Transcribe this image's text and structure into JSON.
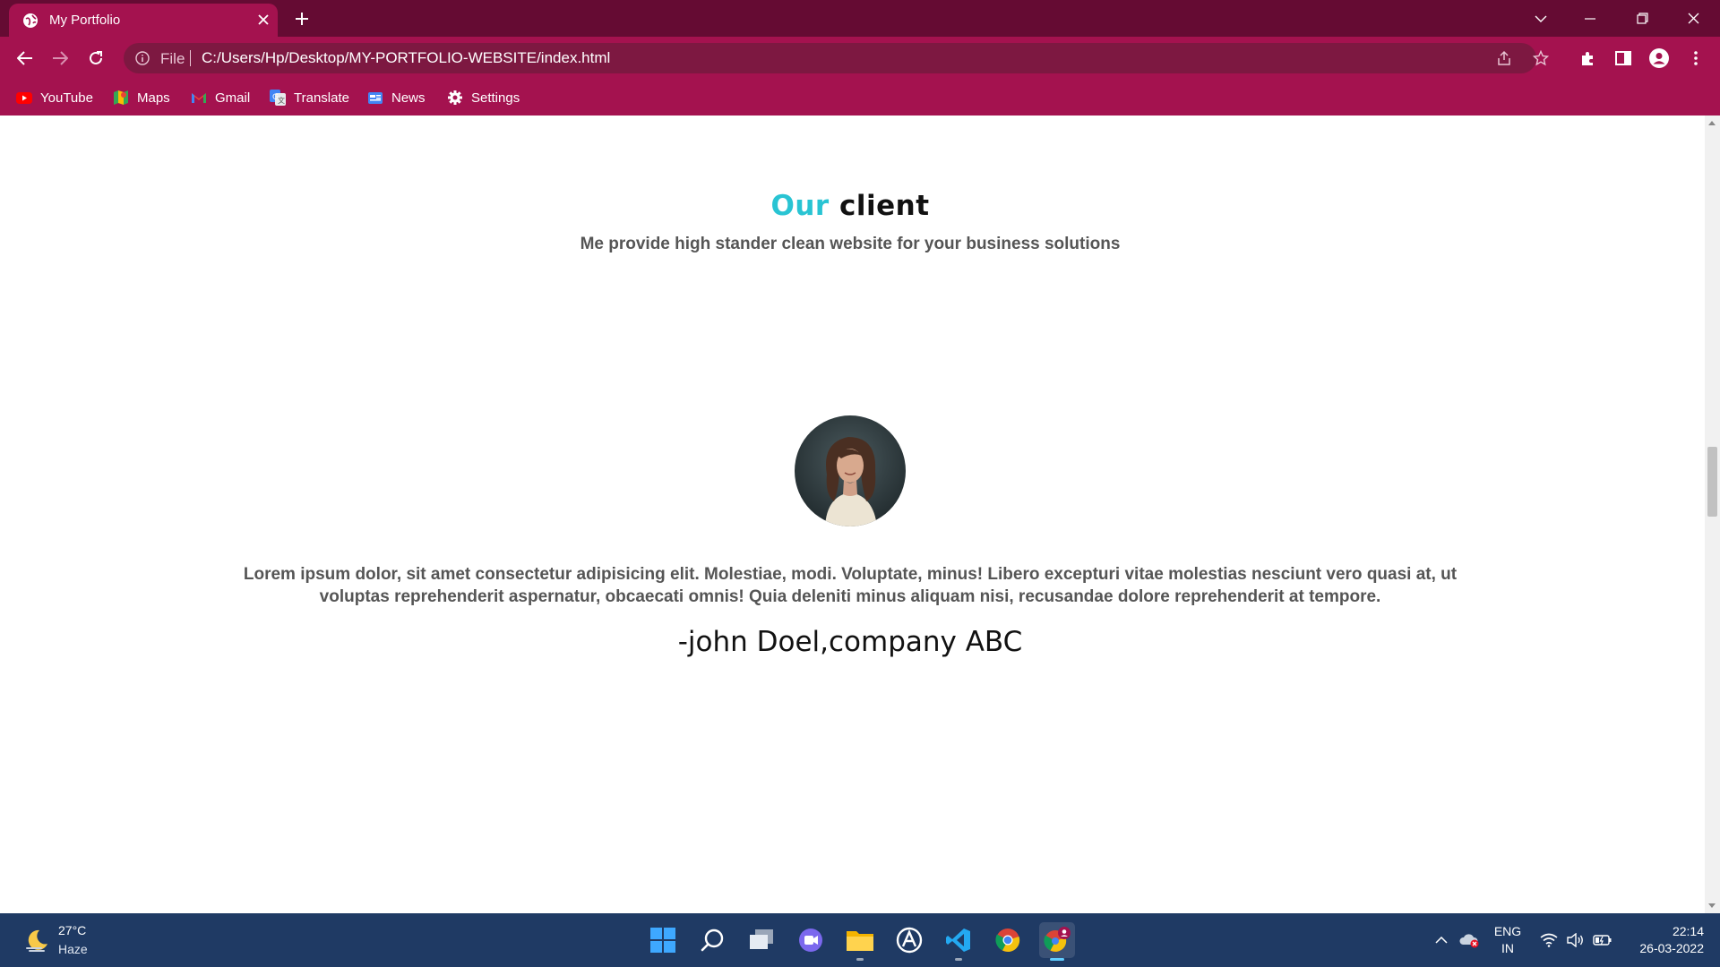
{
  "browser": {
    "tab": {
      "title": "My Portfolio",
      "favicon": "globe-icon"
    },
    "address": {
      "scheme_label": "File",
      "url": "C:/Users/Hp/Desktop/MY-PORTFOLIO-WEBSITE/index.html"
    },
    "bookmarks": [
      {
        "label": "YouTube",
        "icon": "youtube-icon"
      },
      {
        "label": "Maps",
        "icon": "maps-icon"
      },
      {
        "label": "Gmail",
        "icon": "gmail-icon"
      },
      {
        "label": "Translate",
        "icon": "translate-icon"
      },
      {
        "label": "News",
        "icon": "news-icon"
      },
      {
        "label": "Settings",
        "icon": "settings-gear-icon"
      }
    ],
    "colors": {
      "frame": "#650b33",
      "toolbar": "#a4124f",
      "omnibox": "#7d1841"
    }
  },
  "page": {
    "title_accent": "Our",
    "title_rest": "client",
    "subtitle": "Me provide high stander clean website for your business solutions",
    "testimonial": {
      "quote": "Lorem ipsum dolor, sit amet consectetur adipisicing elit. Molestiae, modi. Voluptate, minus! Libero excepturi vitae molestias nesciunt vero quasi at, ut voluptas reprehenderit aspernatur, obcaecati omnis! Quia deleniti minus aliquam nisi, recusandae dolore reprehenderit at tempore.",
      "author": "-john Doel,company ABC"
    },
    "colors": {
      "accent": "#29c4d3",
      "text": "#555555"
    }
  },
  "taskbar": {
    "weather": {
      "temp": "27°C",
      "desc": "Haze"
    },
    "apps": [
      "start-icon",
      "search-icon",
      "task-view-icon",
      "teams-chat-icon",
      "file-explorer-icon",
      "app-store-icon",
      "vscode-icon",
      "chrome-icon",
      "chrome-profile-icon"
    ],
    "language": {
      "line1": "ENG",
      "line2": "IN"
    },
    "clock": {
      "time": "22:14",
      "date": "26-03-2022"
    }
  }
}
